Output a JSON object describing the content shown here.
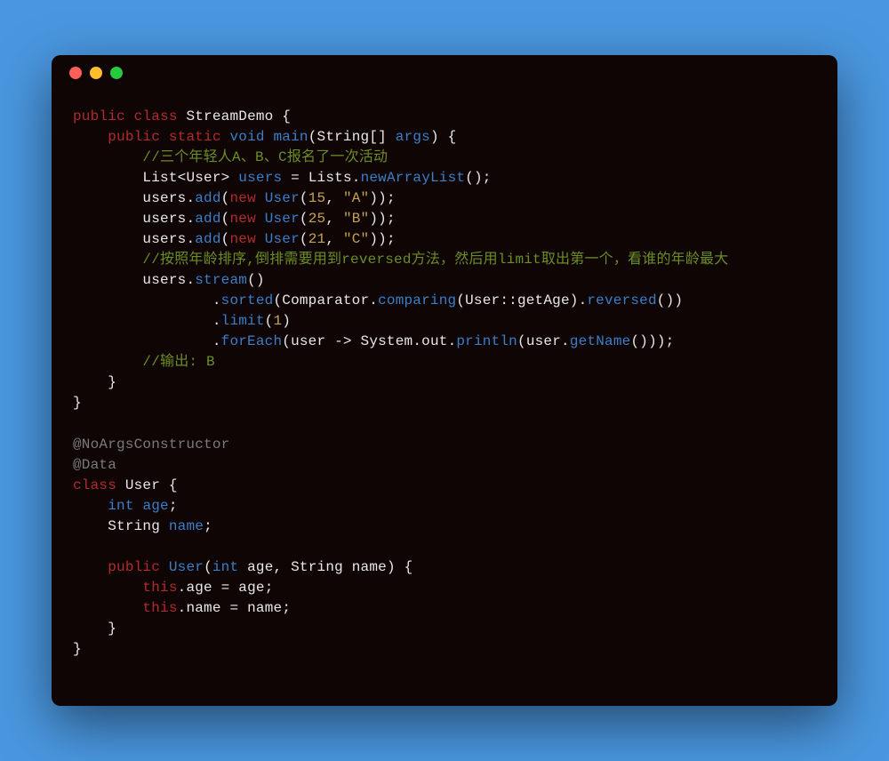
{
  "window": {
    "dots": [
      "red",
      "yellow",
      "green"
    ]
  },
  "colors": {
    "background": "#4a97e0",
    "windowBg": "#100505",
    "dotRed": "#ff5f56",
    "dotYellow": "#ffbd2e",
    "dotGreen": "#27c93f",
    "keyword": "#b22b2b",
    "method": "#3a7fc7",
    "literal": "#c7a252",
    "comment": "#7a7a7a",
    "commentGreen": "#6b8e23",
    "text": "#e8e8e8"
  },
  "tokens": {
    "public": "public",
    "class": "class",
    "static": "static",
    "void": "void",
    "new": "new",
    "this": "this",
    "int": "int",
    "StreamDemo": "StreamDemo",
    "main": "main",
    "String": "String",
    "args": "args",
    "comment1": "//三个年轻人A、B、C报名了一次活动",
    "List": "List",
    "User": "User",
    "users": "users",
    "Lists": "Lists",
    "newArrayList": "newArrayList",
    "add": "add",
    "n15": "15",
    "n25": "25",
    "n21": "21",
    "n1": "1",
    "sA": "\"A\"",
    "sB": "\"B\"",
    "sC": "\"C\"",
    "comment2": "//按照年龄排序,倒排需要用到reversed方法，然后用limit取出第一个，看谁的年龄最大",
    "stream": "stream",
    "sorted": "sorted",
    "Comparator": "Comparator",
    "comparing": "comparing",
    "getAge": "getAge",
    "reversed": "reversed",
    "limit": "limit",
    "forEach": "forEach",
    "user": "user",
    "System": "System",
    "out": "out",
    "println": "println",
    "getName": "getName",
    "comment3": "//输出: B",
    "annNoArgs": "@NoArgsConstructor",
    "annData": "@Data",
    "age": "age",
    "name": "name"
  }
}
